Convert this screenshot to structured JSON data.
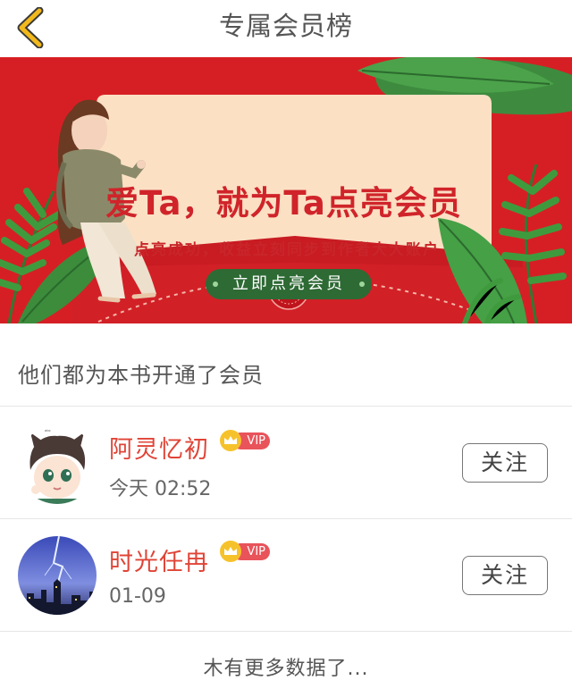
{
  "header": {
    "title": "专属会员榜",
    "back_icon": "chevron-left-icon",
    "accent_color": "#f2b91c"
  },
  "banner": {
    "headline": "爱Ta，就为Ta点亮会员",
    "subtitle": "点亮成功，收益立刻同步到作者大大账户",
    "cta_label": "立即点亮会员",
    "background_color": "#d61f24",
    "cta_color": "#2e6a34"
  },
  "section": {
    "title": "他们都为本书开通了会员"
  },
  "members": [
    {
      "name": "阿灵忆初",
      "badge": "VIP",
      "time": "今天 02:52",
      "follow_label": "关注",
      "avatar": "cartoon-boy-avatar"
    },
    {
      "name": "时光任冉",
      "badge": "VIP",
      "time": "01-09",
      "follow_label": "关注",
      "avatar": "lightning-city-avatar"
    }
  ],
  "footer": {
    "text": "木有更多数据了..."
  },
  "colors": {
    "member_name": "#e04437",
    "vip_badge": "#e9535a",
    "crown": "#f6c22c"
  }
}
